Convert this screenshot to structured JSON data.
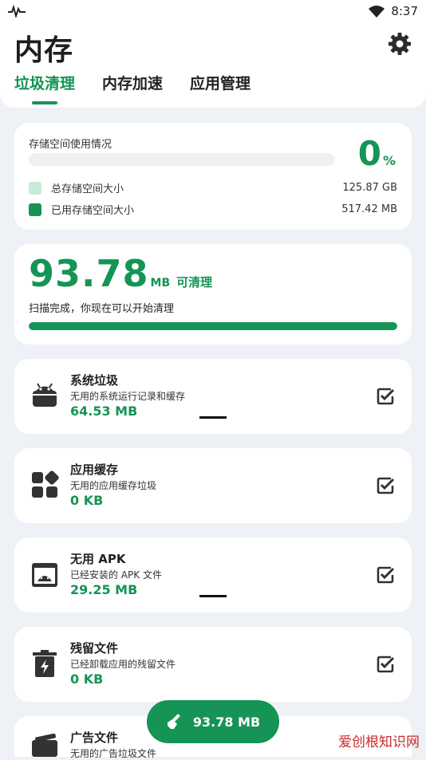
{
  "status_bar": {
    "time": "8:37"
  },
  "header": {
    "title": "内存",
    "tabs": [
      {
        "label": "垃圾清理",
        "active": true
      },
      {
        "label": "内存加速",
        "active": false
      },
      {
        "label": "应用管理",
        "active": false
      }
    ]
  },
  "storage": {
    "label": "存储空间使用情况",
    "percent": "0",
    "percent_unit": "%",
    "used_fraction": 0,
    "total_label": "总存储空间大小",
    "total_value": "125.87 GB",
    "used_label": "已用存储空间大小",
    "used_value": "517.42 MB"
  },
  "scan": {
    "size": "93.78",
    "unit": "MB",
    "tag": "可清理",
    "message": "扫描完成，你现在可以开始清理",
    "progress": 1.0
  },
  "items": [
    {
      "title": "系统垃圾",
      "desc": "无用的系统运行记录和缓存",
      "size": "64.53 MB",
      "icon": "android-icon"
    },
    {
      "title": "应用缓存",
      "desc": "无用的应用缓存垃圾",
      "size": "0 KB",
      "icon": "apps-grid-icon"
    },
    {
      "title": "无用 APK",
      "desc": "已经安装的 APK 文件",
      "size": "29.25 MB",
      "icon": "apk-box-icon"
    },
    {
      "title": "残留文件",
      "desc": "已经卸载应用的残留文件",
      "size": "0 KB",
      "icon": "trash-bolt-icon"
    },
    {
      "title": "广告文件",
      "desc": "无用的广告垃圾文件",
      "size": "",
      "icon": "ad-icon"
    }
  ],
  "fab": {
    "label": "93.78 MB"
  },
  "watermark": {
    "text_red": "爱创根知识网",
    "text_blue": ""
  },
  "colors": {
    "accent": "#159455",
    "background": "#eef1f5",
    "card": "#ffffff",
    "legend_total": "#c8ead6"
  }
}
